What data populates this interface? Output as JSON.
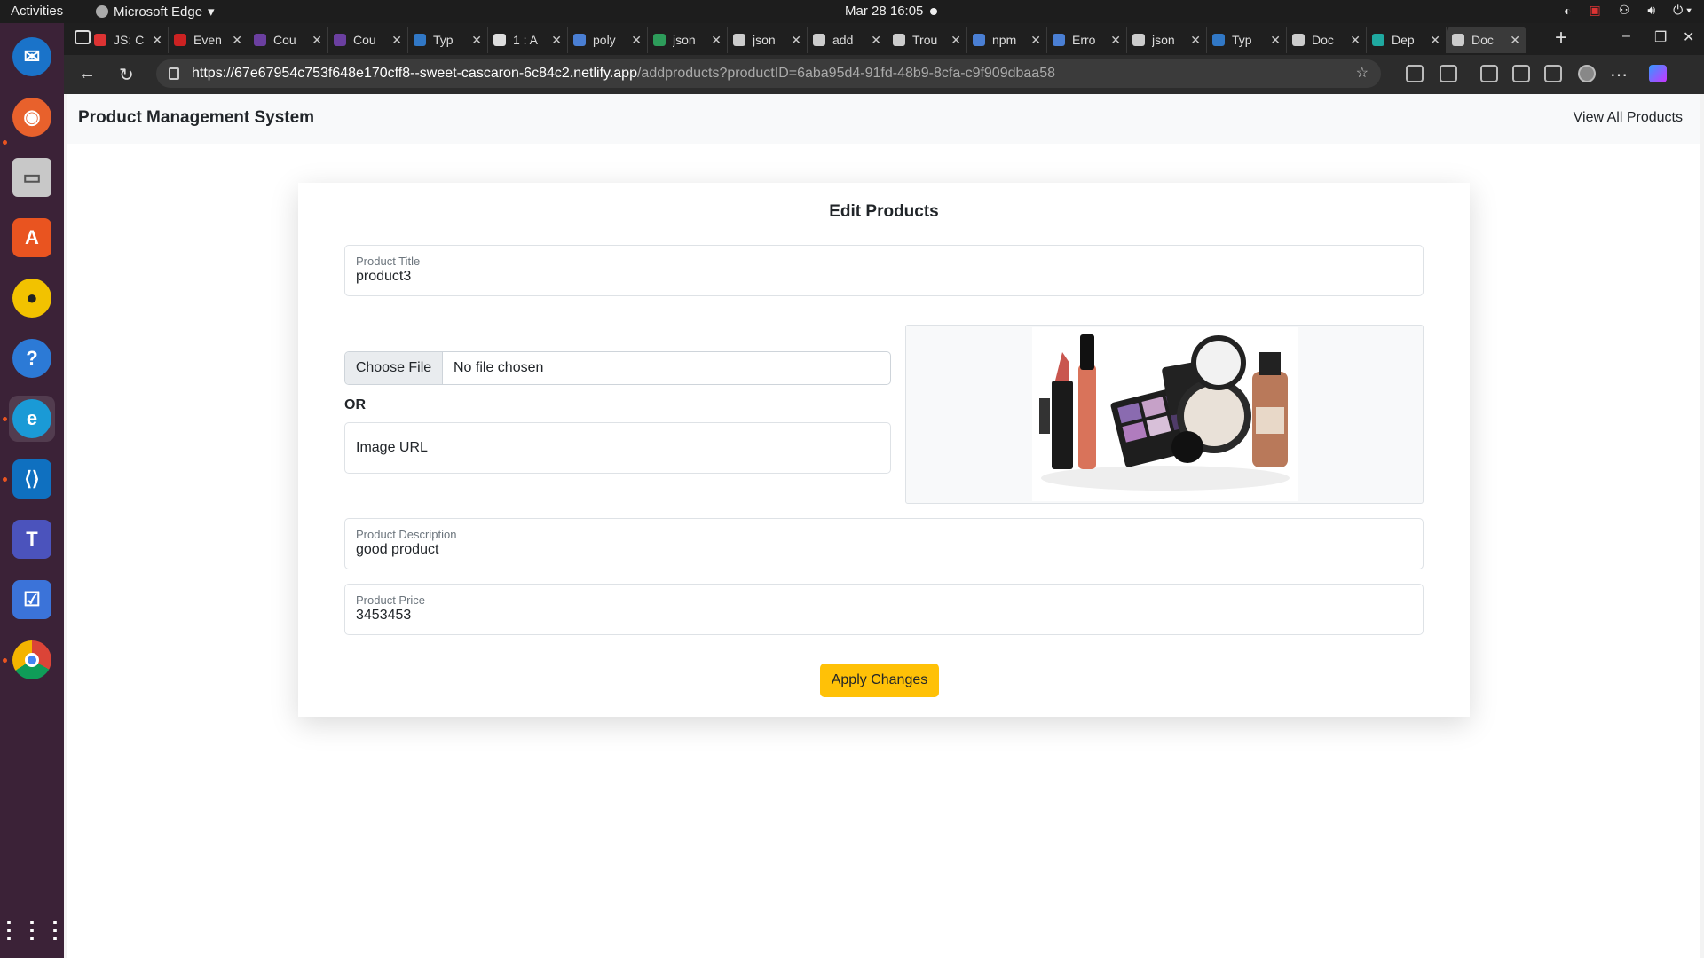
{
  "system": {
    "activities": "Activities",
    "app_name": "Microsoft Edge",
    "clock": "Mar 28  16:05"
  },
  "browser": {
    "tabs": [
      {
        "label": "JS: C",
        "color": "#d33"
      },
      {
        "label": "Even",
        "color": "#c22"
      },
      {
        "label": "Cou",
        "color": "#6b3fa0"
      },
      {
        "label": "Cou",
        "color": "#6b3fa0"
      },
      {
        "label": "Typ",
        "color": "#3178c6"
      },
      {
        "label": "1 : A",
        "color": "#ddd"
      },
      {
        "label": "poly",
        "color": "#4a7fd4"
      },
      {
        "label": "json",
        "color": "#2d9c5a"
      },
      {
        "label": "json",
        "color": "#ccc"
      },
      {
        "label": "add",
        "color": "#ccc"
      },
      {
        "label": "Trou",
        "color": "#ccc"
      },
      {
        "label": "npm",
        "color": "#4a7fd4"
      },
      {
        "label": "Erro",
        "color": "#4a7fd4"
      },
      {
        "label": "json",
        "color": "#ccc"
      },
      {
        "label": "Typ",
        "color": "#3178c6"
      },
      {
        "label": "Doc",
        "color": "#ccc"
      },
      {
        "label": "Dep",
        "color": "#1fa9a0"
      },
      {
        "label": "Doc",
        "color": "#ccc"
      }
    ],
    "url_host": "https://67e67954c753f648e170cff8--sweet-cascaron-6c84c2.netlify.app",
    "url_path": "/addproducts?productID=6aba95d4-91fd-48b9-8cfa-c9f909dbaa58"
  },
  "page": {
    "brand": "Product Management System",
    "nav_link": "View All Products",
    "card_title": "Edit Products",
    "title_field": {
      "label": "Product Title",
      "value": "product3"
    },
    "file": {
      "button": "Choose File",
      "status": "No file chosen"
    },
    "or_label": "OR",
    "image_url_placeholder": "Image URL",
    "description_field": {
      "label": "Product Description",
      "value": "good product"
    },
    "price_field": {
      "label": "Product Price",
      "value": "3453453"
    },
    "apply_button": "Apply Changes"
  },
  "colors": {
    "accent_button": "#ffc107",
    "navbar_bg": "#f8f9fa",
    "dock_bg": "#3b2237"
  }
}
